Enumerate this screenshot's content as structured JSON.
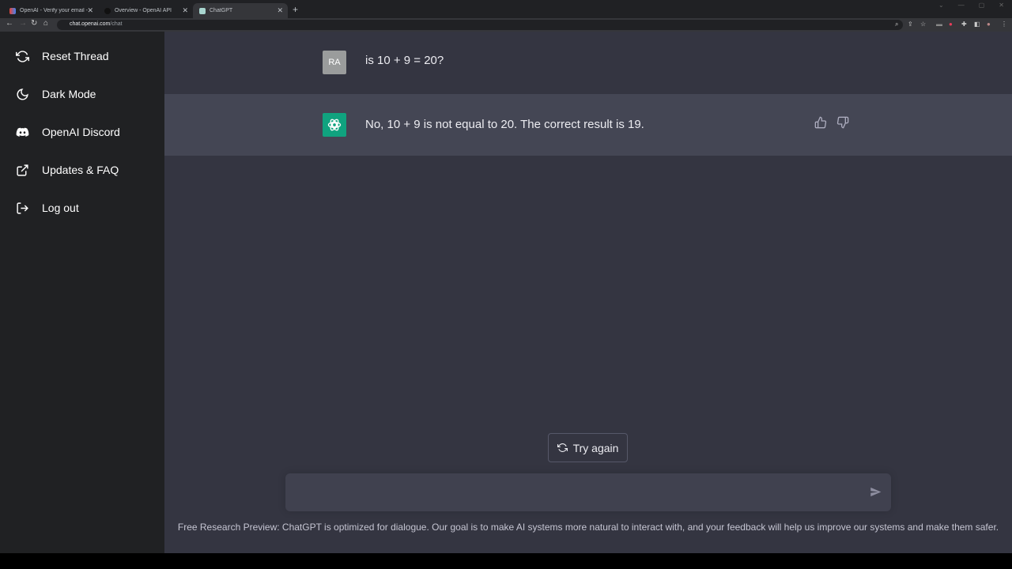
{
  "browser": {
    "tabs": [
      {
        "title": "OpenAI - Verify your email - rali...",
        "favicon": "gmail-icon"
      },
      {
        "title": "Overview - OpenAI API",
        "favicon": "openai-icon"
      },
      {
        "title": "ChatGPT",
        "favicon": "chatgpt-icon",
        "active": true
      }
    ],
    "url_host": "chat.openai.com",
    "url_path": "/chat"
  },
  "sidebar": {
    "items": [
      {
        "label": "Reset Thread",
        "icon": "refresh-icon"
      },
      {
        "label": "Dark Mode",
        "icon": "moon-icon"
      },
      {
        "label": "OpenAI Discord",
        "icon": "discord-icon"
      },
      {
        "label": "Updates & FAQ",
        "icon": "external-link-icon"
      },
      {
        "label": "Log out",
        "icon": "logout-icon"
      }
    ]
  },
  "chat": {
    "user": {
      "initials": "RA",
      "text": "is 10 + 9 = 20?"
    },
    "assistant": {
      "text": "No, 10 + 9 is not equal to 20. The correct result is 19."
    }
  },
  "try_again_label": "Try again",
  "input_placeholder": "",
  "footer": "Free Research Preview: ChatGPT is optimized for dialogue. Our goal is to make AI systems more natural to interact with, and your feedback will help us improve our systems and make them safer.",
  "colors": {
    "sidebar": "#202123",
    "main": "#343541",
    "assistant_row": "#444654",
    "assistant_avatar": "#10a37f",
    "user_avatar": "#9a9c9c"
  }
}
